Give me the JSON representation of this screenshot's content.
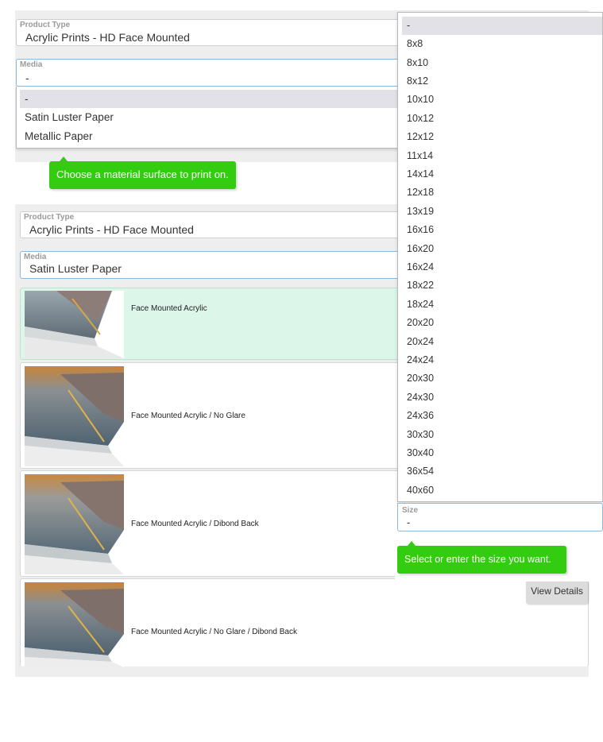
{
  "top": {
    "product_type": {
      "label": "Product Type",
      "value": "Acrylic Prints - HD Face Mounted"
    },
    "media": {
      "label": "Media",
      "value": "-",
      "options": [
        {
          "label": "-",
          "selected": true
        },
        {
          "label": "Satin Luster Paper",
          "selected": false
        },
        {
          "label": "Metallic Paper",
          "selected": false
        }
      ]
    },
    "tooltip": "Choose a material surface to print on."
  },
  "bottom": {
    "product_type": {
      "label": "Product Type",
      "value": "Acrylic Prints - HD Face Mounted"
    },
    "media": {
      "label": "Media",
      "value": "Satin Luster Paper"
    },
    "finishes": [
      {
        "label": "Face Mounted Acrylic",
        "selected": true
      },
      {
        "label": "Face Mounted Acrylic / No Glare",
        "selected": false
      },
      {
        "label": "Face Mounted Acrylic / Dibond Back",
        "selected": false
      },
      {
        "label": "Face Mounted Acrylic / No Glare / Dibond Back",
        "selected": false
      }
    ],
    "view_details": "View Details"
  },
  "size": {
    "label": "Size",
    "value": "-",
    "tooltip": "Select or enter the size you want.",
    "options": [
      "-",
      "8x8",
      "8x10",
      "8x12",
      "10x10",
      "10x12",
      "12x12",
      "11x14",
      "14x14",
      "12x18",
      "13x19",
      "16x16",
      "16x20",
      "16x24",
      "18x22",
      "18x24",
      "20x20",
      "20x24",
      "24x24",
      "20x30",
      "24x30",
      "24x36",
      "30x30",
      "30x40",
      "36x54",
      "40x60"
    ],
    "selected_index": 0
  },
  "colors": {
    "tooltip_green": "#33cc11",
    "selected_card": "#ddf6ea",
    "focus_border": "#8db8d8"
  }
}
